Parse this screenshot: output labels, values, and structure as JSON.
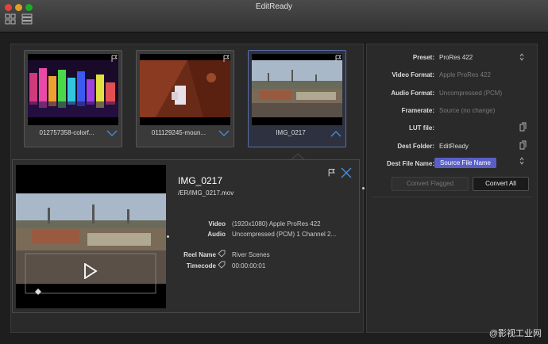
{
  "window": {
    "title": "EditReady",
    "traffic_lights": {
      "close_color": "#e0443e",
      "minimize_color": "#dea123",
      "zoom_color": "#1aab29"
    },
    "toolbar": {
      "grid_view_icon": "grid-icon",
      "list_view_icon": "list-icon"
    }
  },
  "clips": [
    {
      "name": "012757358-colorf...",
      "selected": false
    },
    {
      "name": "011129245-moun...",
      "selected": false
    },
    {
      "name": "IMG_0217",
      "selected": true
    }
  ],
  "detail": {
    "title": "IMG_0217",
    "path": "/ER/IMG_0217.mov",
    "video_label": "Video",
    "video_value": "(1920x1080) Apple ProRes 422",
    "audio_label": "Audio",
    "audio_value": "Uncompressed (PCM) 1 Channel 2...",
    "reel_label": "Reel Name",
    "reel_value": "River Scenes",
    "timecode_label": "Timecode",
    "timecode_value": "00:00:00:01"
  },
  "settings": {
    "preset_label": "Preset:",
    "preset_value": "ProRes 422",
    "video_format_label": "Video Format:",
    "video_format_value": "Apple ProRes 422",
    "audio_format_label": "Audio Format:",
    "audio_format_value": "Uncompressed (PCM)",
    "framerate_label": "Framerate:",
    "framerate_value": "Source (no change)",
    "lut_label": "LUT file:",
    "lut_value": "",
    "dest_folder_label": "Dest Folder:",
    "dest_folder_value": "EditReady",
    "dest_name_label": "Dest File Name:",
    "dest_name_token": "Source File Name",
    "convert_flagged": "Convert Flagged",
    "convert_all": "Convert All"
  },
  "watermark": "@影视工业网",
  "colors": {
    "accent": "#5b6fa8",
    "token_bg": "#5a5fc8",
    "chevron": "#4a8ed8"
  }
}
